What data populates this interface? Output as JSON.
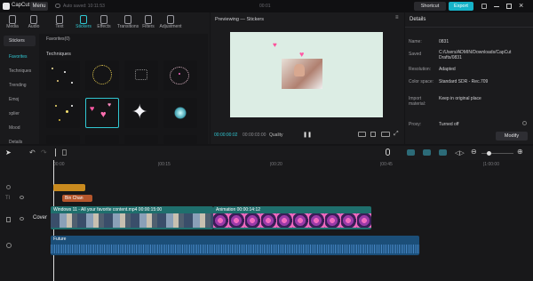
{
  "app": {
    "name": "CapCut",
    "menu": "Menu",
    "autosave": "Auto saved: 10:11:53",
    "time_center": "00:01",
    "shortcut": "Shortcut",
    "export": "Export"
  },
  "tabs": [
    {
      "label": "Media"
    },
    {
      "label": "Audio"
    },
    {
      "label": "Text"
    },
    {
      "label": "Stickers"
    },
    {
      "label": "Effects"
    },
    {
      "label": "Transitions"
    },
    {
      "label": "Filters"
    },
    {
      "label": "Adjustment"
    }
  ],
  "categories": [
    {
      "label": "Stickers"
    },
    {
      "label": "Favorites"
    },
    {
      "label": "Techniques"
    },
    {
      "label": "Trending"
    },
    {
      "label": "Emoj"
    },
    {
      "label": "xplier"
    },
    {
      "label": "Mood"
    },
    {
      "label": "Details"
    }
  ],
  "sticker_panel": {
    "favorites": "Favorites(0)",
    "section": "Techniques"
  },
  "preview": {
    "title": "Previewing — Stickers",
    "current": "00:00:00:02",
    "total": "00:00:03:00",
    "quality": "Quality"
  },
  "details": {
    "title": "Details",
    "rows": [
      {
        "label": "Name:",
        "value": "0831"
      },
      {
        "label": "Saved",
        "value": "C:/Users/ADMIN/Downloads/CapCut Drafts/0831"
      },
      {
        "label": "Resolution:",
        "value": "Adapted"
      },
      {
        "label": "Color space:",
        "value": "Standard SDR - Rec.709"
      },
      {
        "label": "Import material:",
        "value": "Keep in original place"
      },
      {
        "label": "Proxy:",
        "value": "Turned off"
      }
    ],
    "modify": "Modify"
  },
  "timeline": {
    "ticks": [
      "00:00",
      "|00:15",
      "|00:20",
      "|00:45",
      "|1:00:00"
    ],
    "cover": "Cover",
    "clip_text": "Bin Chan",
    "clip_video": "Windows 11 - All your favorite content.mp4   00:00:15:00",
    "clip_anim": "Animation   00:00:14:12",
    "clip_audio": "Future"
  },
  "colors": {
    "accent": "#31c7d2",
    "export": "#16b3c9",
    "sticker_clip": "#c98a1e",
    "text_clip": "#b5562c",
    "video_clip": "#1f6f6d",
    "audio_clip": "#1b4e78"
  }
}
